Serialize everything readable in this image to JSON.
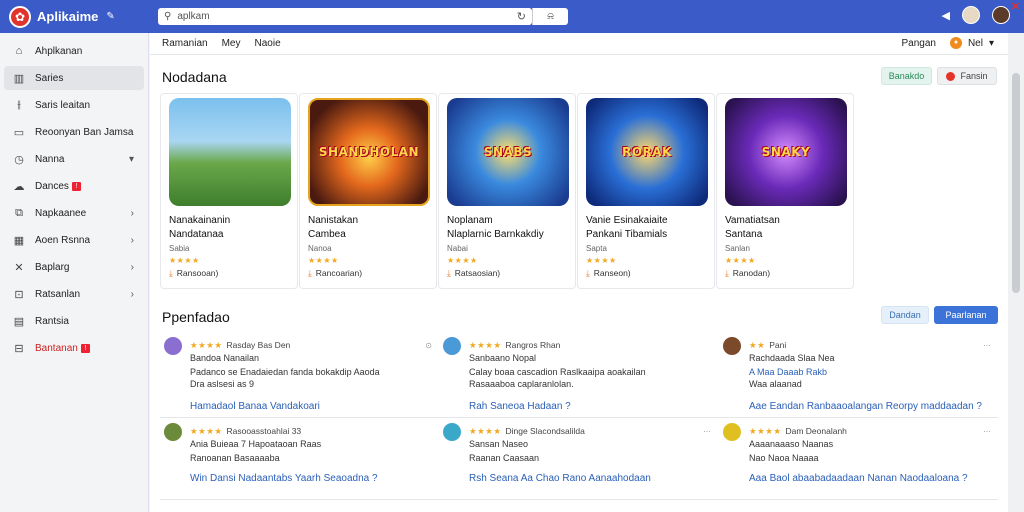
{
  "app": {
    "title": "Aplikaime",
    "logo_icon": "app-logo-icon"
  },
  "search": {
    "placeholder": "",
    "value": "aplkam"
  },
  "topbar_right": {
    "icons": [
      "send-icon",
      "avatar",
      "avatar"
    ]
  },
  "sidebar": {
    "items": [
      {
        "label": "Ahplkanan",
        "icon": "home-icon"
      },
      {
        "label": "Saries",
        "icon": "library-icon",
        "active": true
      },
      {
        "label": "Saris leaitan",
        "icon": "chart-icon"
      },
      {
        "label": "Reoonyan Ban Jamsa",
        "icon": "calendar-icon"
      },
      {
        "label": "Nanna",
        "icon": "clock-icon",
        "chevron": true
      },
      {
        "label": "Dances",
        "icon": "cloud-icon",
        "badge": "!"
      },
      {
        "label": "Napkaanee",
        "icon": "puzzle-icon",
        "chevron": true
      },
      {
        "label": "Aoen Rsnna",
        "icon": "grid-icon",
        "chevron": true
      },
      {
        "label": "Baplarg",
        "icon": "tools-icon",
        "chevron": true
      },
      {
        "label": "Ratsanlan",
        "icon": "box-icon",
        "chevron": true
      },
      {
        "label": "Rantsia",
        "icon": "building-icon"
      },
      {
        "label": "Bantanan",
        "icon": "gift-icon",
        "badge": "!",
        "red": true
      }
    ]
  },
  "subnav": {
    "tabs": [
      "Ramanian",
      "Mey",
      "Naoie"
    ],
    "right_label": "Pangan",
    "user_label": "Nel"
  },
  "featured": {
    "title": "Nodadana",
    "btn_green": "Banakdo",
    "btn_gray": "Fansin",
    "cards": [
      {
        "art": "",
        "name1": "Nanakainanin",
        "name2": "Nandatanaa",
        "meta": "Sabia",
        "stars": "★★★★",
        "downloads": "Ransooan)"
      },
      {
        "art": "SHANDHOLAN",
        "name1": "Nanistakan",
        "name2": "Cambea",
        "meta": "Nanoa",
        "stars": "★★★★",
        "downloads": "Rancoarian)"
      },
      {
        "art": "SNABS",
        "name1": "Noplanam",
        "name2": "Nlaplarnic Barnkakdiy",
        "meta": "Nabai",
        "stars": "★★★★",
        "downloads": "Ratsaosian)"
      },
      {
        "art": "RORAK",
        "name1": "Vanie Esinakaiaite",
        "name2": "Pankani Tibamials",
        "meta": "Sapta",
        "stars": "★★★★",
        "downloads": "Ranseon)"
      },
      {
        "art": "SNAKY",
        "name1": "Vamatiatsan",
        "name2": "Santana",
        "meta": "Sanlan",
        "stars": "★★★★",
        "downloads": "Ranodan)"
      }
    ]
  },
  "popular": {
    "title": "Ppenfadao",
    "btn_light": "Dandan",
    "btn_blue": "Paarlanan",
    "reviews": [
      {
        "stars": "★★★★",
        "name": "Rasday Bas Den",
        "l2": "Bandoa Nanailan",
        "l3": "Padanco se Enadaiedan fanda bokakdip Aaoda",
        "l4": "Dra aslsesi as 9",
        "link": "Hamadaol Banaa Vandakoari"
      },
      {
        "stars": "★★★★",
        "name": "Rangros Rhan",
        "l2": "Sanbaano Nopal",
        "l3": "Calay boaa cascadion Raslkaaipa aoakailan",
        "l4": "Rasaaaboa caplaranlolan.",
        "link": "Rah Saneoa Hadaan ?"
      },
      {
        "stars": "★★",
        "name": "Pani",
        "l2": "Rachdaada Slaa Nea",
        "l3": "A Maa Daaab Rakb",
        "l4": "Waa alaanad",
        "link": "Aae Eandan Ranbaaoalangan Reorpy maddaadan ?"
      },
      {
        "stars": "★★★★",
        "name": "Rasooasstoahlai 33",
        "l2": "Ania Buieaa 7 Hapoataoan Raas",
        "l3": "Ranoanan Basaaaaba",
        "l4": "",
        "link": "Win Dansi Nadaantabs Yaarh Seaoadna ?"
      },
      {
        "stars": "★★★★",
        "name": "Dinge Slacondsalilda",
        "l2": "Sansan Naseo",
        "l3": "Raanan Caasaan",
        "l4": "",
        "link": "Rsh Seana Aa Chao Rano Aanaahodaan"
      },
      {
        "stars": "★★★★",
        "name": "Dam Deonalanh",
        "l2": "Aaaanaaaso Naanas",
        "l3": "Nao Naoa Naaaa",
        "l4": "",
        "link": "Aaa Baol abaabadaadaan Nanan Naodaaloana ?"
      }
    ]
  },
  "colors": {
    "topbar": "#3a5bc8",
    "accent_blue": "#3b73d8",
    "star": "#f0a820"
  }
}
